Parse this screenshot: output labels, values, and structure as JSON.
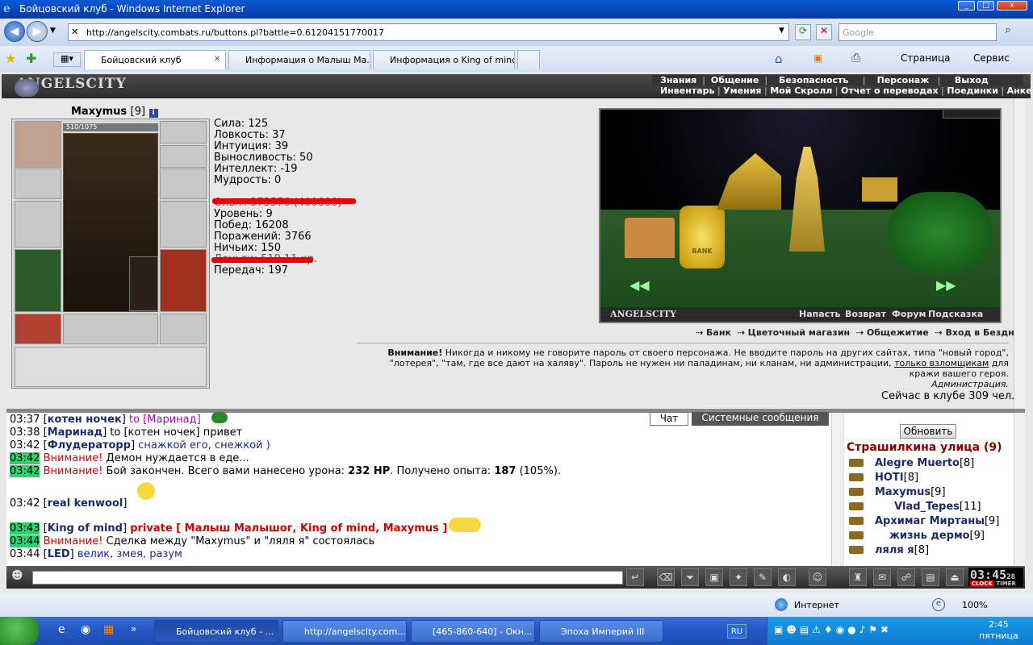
{
  "window": {
    "title": "Бойцовский клуб - Windows Internet Explorer",
    "min": "_",
    "max": "□",
    "close": "x"
  },
  "address": {
    "url": "http://angelscity.combats.ru/buttons.pl?battle=0.61204151770017",
    "search_placeholder": "Google"
  },
  "tabs": [
    {
      "label": "Бойцовский клуб",
      "active": true
    },
    {
      "label": "Информация о Малыш Ма..."
    },
    {
      "label": "Информация о King of mind"
    }
  ],
  "toolbar": {
    "page": "Страница",
    "service": "Сервис"
  },
  "game": {
    "logo": "ANGELSCITY",
    "menu_top": [
      "Знания",
      "Общение",
      "Безопасность",
      "Персонаж",
      "Выход"
    ],
    "menu_bottom": [
      "Инвентарь",
      "Умения",
      "Мой Скролл",
      "Отчет о переводах",
      "Поединки",
      "Анкета"
    ],
    "character": {
      "name": "Maxymus",
      "level": "[9]",
      "hp": "510/1075"
    },
    "stats": [
      "Сила: 125",
      "Ловкость: 37",
      "Интуиция: 39",
      "Выносливость: 50",
      "Интеллект: -19",
      "Мудрость: 0"
    ],
    "hidden1": "Опыт: 373576 (400000)",
    "stats2": [
      "Уровень: 9",
      "Побед: 16208",
      "Поражений: 3766",
      "Ничьих: 150"
    ],
    "hidden2": "Деньги: 519.11 кр.",
    "transfers": "Передач: 197",
    "scene_logo": "ANGELSCITY",
    "scene_bank": "BANK",
    "scene_links": [
      "Напасть",
      "Возврат",
      "Форум",
      "Подсказка"
    ],
    "locations": [
      "Банк",
      "Цветочный магазин",
      "Общежитие",
      "Вход в Бездну"
    ],
    "warning_bold": "Внимание!",
    "warning_text": " Никогда и никому не говорите пароль от своего персонажа. Не вводите пароль на других сайтах, типа \"новый город\", \"лотерея\", \"там, где все дают на халяву\". Пароль не нужен ни паладинам, ни кланам, ни администрации, ",
    "warning_link": "только взломщикам",
    "warning_end": " для кражи вашего героя.",
    "warning_sign": "Администрация.",
    "online": "Сейчас в клубе 309 чел."
  },
  "chat": {
    "tabs": [
      "Чат",
      "Системные сообщения"
    ],
    "lines": [
      {
        "time": "03:37",
        "nick": "котен ночек",
        "to": "to [Маринад]",
        "text": ""
      },
      {
        "time": "03:38",
        "nick": "Маринад",
        "to": "to [котен ночек]",
        "text": " привет"
      },
      {
        "time": "03:42",
        "nick": "Флудераторр",
        "to": "",
        "text": " снажкой его, снежкой )"
      },
      {
        "time": "03:42",
        "system": "Внимание!",
        "text": " Демон нуждается в еде..."
      },
      {
        "time": "03:42",
        "system": "Внимание!",
        "text": " Бой закончен. Всего вами нанесено урона: ",
        "b1": "232 HP",
        "t2": ". Получено опыта: ",
        "b2": "187",
        "t3": " (105%)."
      },
      {
        "time": "03:42",
        "nick": "real kenwool",
        "text": ""
      },
      {
        "time": "03:43",
        "nick": "King of mind",
        "private": "private [ Малыш Малышог, King of mind, Maxymus ]"
      },
      {
        "time": "03:44",
        "system": "Внимание!",
        "text": " Сделка между \"Maxymus\" и \"ляля я\" состоялась"
      },
      {
        "time": "03:44",
        "nick": "LED",
        "text": " велик, змея, разум"
      }
    ]
  },
  "userlist": {
    "refresh": "Обновить",
    "location": "Страшилкина улица (9)",
    "users": [
      {
        "name": "Alegre Muerto",
        "lvl": "[8]"
      },
      {
        "name": "HOTI",
        "lvl": "[8]"
      },
      {
        "name": "Maxymus",
        "lvl": "[9]"
      },
      {
        "name": "Vlad_Tepes",
        "lvl": "[11]"
      },
      {
        "name": "Архимаг Миртаны",
        "lvl": "[9]"
      },
      {
        "name": "жизнь дермо",
        "lvl": "[9]"
      },
      {
        "name": "ляля я",
        "lvl": "[8]"
      }
    ]
  },
  "clock": {
    "time": "03:45",
    "sec": "28",
    "labels": [
      "CLOCK",
      "TIMER"
    ]
  },
  "statusbar": {
    "zone": "Интернет",
    "zoom": "100%"
  },
  "taskbar": {
    "items": [
      "Бойцовский клуб - ...",
      "http://angelscity.com...",
      "[465-860-640] - Окн...",
      "Эпоха Империй III"
    ],
    "lang": "RU",
    "time": "2:45",
    "day": "пятница"
  }
}
